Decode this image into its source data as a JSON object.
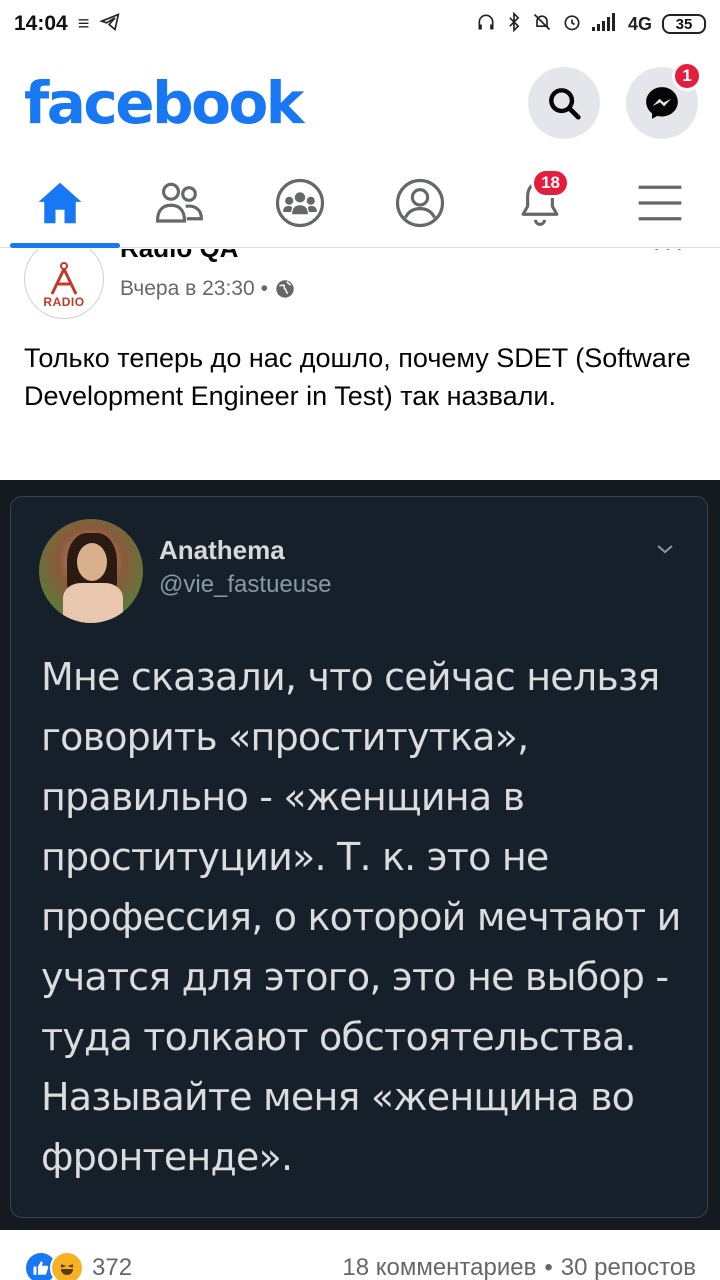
{
  "status_bar": {
    "time": "14:04",
    "network": "4G",
    "battery": "35"
  },
  "header": {
    "logo": "facebook",
    "messenger_badge": "1",
    "brand_color": "#1877f2"
  },
  "nav": {
    "notifications_badge": "18",
    "active_tab": "home",
    "tabs": [
      "home-icon",
      "friends-icon",
      "groups-icon",
      "profile-icon",
      "bell-icon",
      "menu-icon"
    ]
  },
  "post": {
    "page_name": "Radio QA",
    "avatar_text": "RADIO",
    "time": "Вчера в 23:30",
    "separator": "•",
    "text": "Только теперь до нас дошло, почему SDET (Software Development Engineer in Test) так назвали."
  },
  "tweet": {
    "name": "Anathema",
    "handle": "@vie_fastueuse",
    "text": "Мне сказали, что сейчас нельзя говорить «проститутка», правильно - «женщина в проституции». Т. к. это не профессия, о которой мечтают и учатся для этого, это не выбор - туда толкают обстоятельства. Называйте меня «женщина во фронтенде»."
  },
  "reactions": {
    "count": "372",
    "comments": "18 комментариев",
    "dot": "•",
    "shares": "30 репостов"
  }
}
